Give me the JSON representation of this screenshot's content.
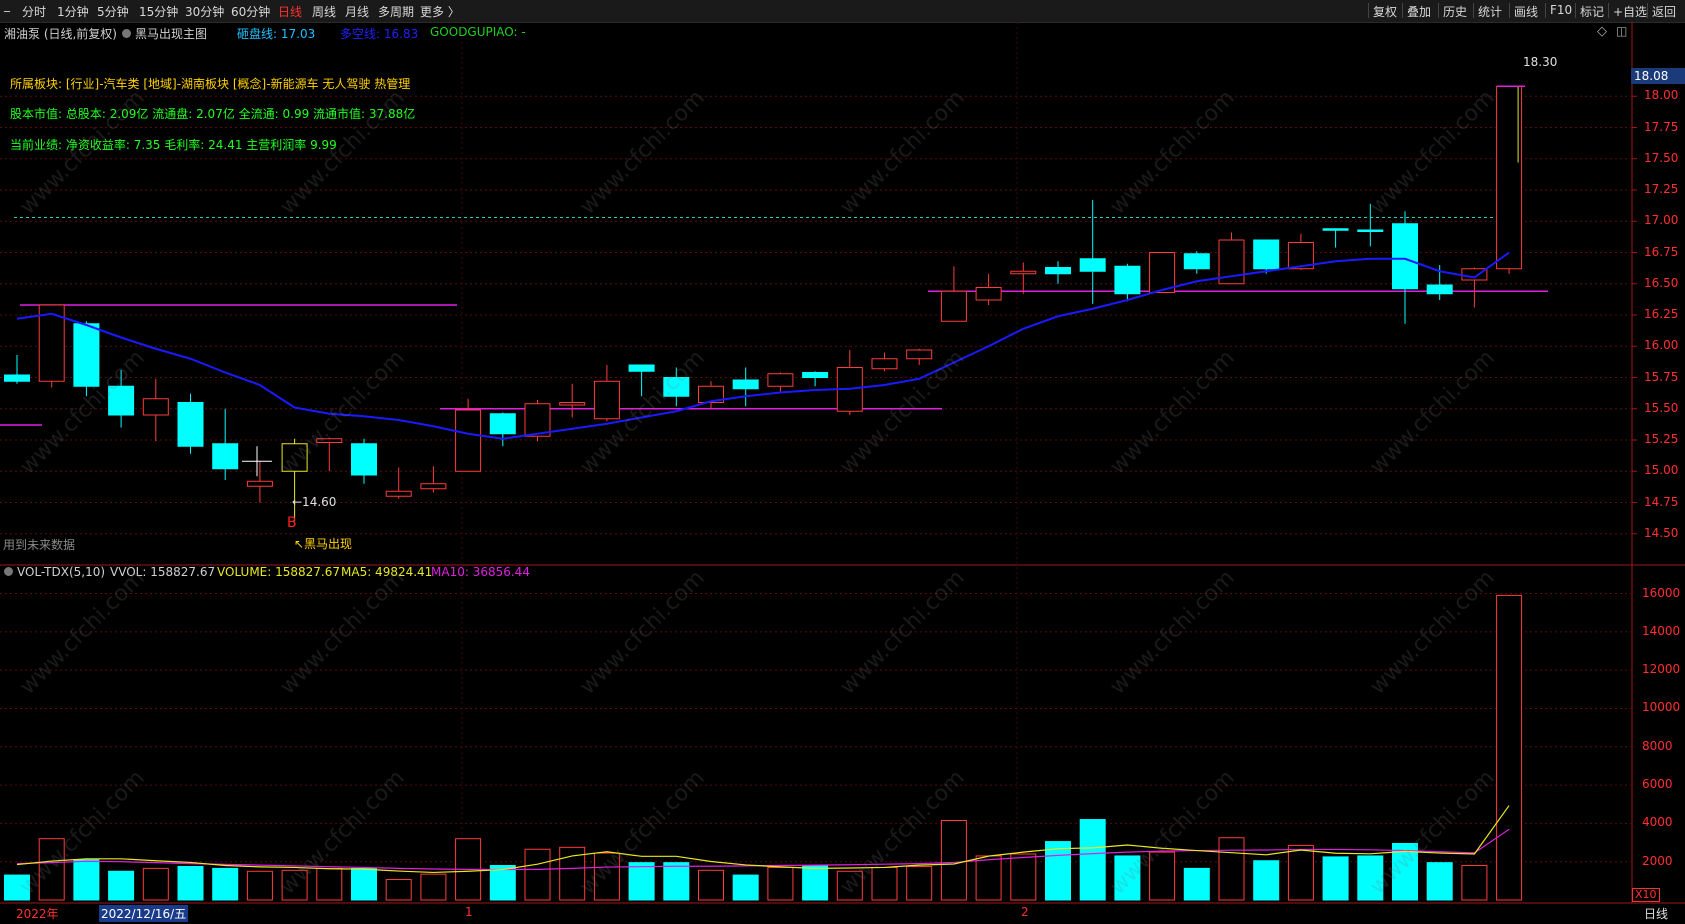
{
  "toolbar": {
    "periods": [
      "分时",
      "1分钟",
      "5分钟",
      "15分钟",
      "30分钟",
      "60分钟",
      "日线",
      "周线",
      "月线",
      "多周期",
      "更多 〉"
    ],
    "active_period": "日线",
    "right_buttons": [
      "复权",
      "叠加",
      "历史",
      "统计",
      "画线",
      "F10",
      "标记",
      "+自选",
      "返回"
    ],
    "minimize": "_",
    "close": "□"
  },
  "header": {
    "stock_name": "湘油泵 (日线,前复权)",
    "indicator_name": "黑马出现主图",
    "line1_label": "砸盘线: 17.03",
    "line2_label": "多空线: 16.83",
    "line3_label": "GOODGUPIAO: -"
  },
  "info": {
    "sector": "所属板块: [行业]-汽车类 [地域]-湖南板块 [概念]-新能源车 无人驾驶 热管理",
    "capital": "股本市值: 总股本: 2.09亿 流通盘: 2.07亿 全流通: 0.99 流通市值: 37.88亿",
    "performance": "当前业绩: 净资收益率: 7.35 毛利率: 24.41 主营利润率 9.99"
  },
  "price_axis": {
    "labels": [
      "18.00",
      "17.75",
      "17.50",
      "17.25",
      "17.00",
      "16.75",
      "16.50",
      "16.25",
      "16.00",
      "15.75",
      "15.50",
      "15.25",
      "15.00",
      "14.75",
      "14.50"
    ],
    "current_price": "18.08",
    "high_marker": "18.30",
    "low_marker": "←14.60"
  },
  "signals": {
    "buy_letter": "B",
    "buy_text": "↖黑马出现",
    "future_note": "用到未来数据"
  },
  "volume": {
    "indicator": "VOL-TDX(5,10)",
    "vvol": "VVOL: 158827.67",
    "volume": "VOLUME: 158827.67",
    "ma5": "MA5: 49824.41",
    "ma10": "MA10: 36856.44",
    "axis_labels": [
      "16000",
      "14000",
      "12000",
      "10000",
      "8000",
      "6000",
      "4000",
      "2000"
    ],
    "unit": "X10"
  },
  "timeline": {
    "year": "2022年",
    "cursor_date": "2022/12/16/五",
    "month1": "1",
    "month2": "2",
    "period_label": "日线"
  },
  "watermark": "www.cfchi.com",
  "colors": {
    "up": "#ff3b3b",
    "down": "#00ffff",
    "ma_line": "#1a1aff",
    "magenta": "#e020e0",
    "yellow": "#e8e820",
    "green_text": "#20ff20",
    "gold_text": "#ffd000"
  },
  "chart_data": {
    "type": "candlestick",
    "candles": [
      {
        "o": 15.77,
        "c": 15.72,
        "h": 15.93,
        "l": 15.7
      },
      {
        "o": 15.72,
        "c": 16.33,
        "h": 16.33,
        "l": 15.67
      },
      {
        "o": 16.18,
        "c": 15.68,
        "h": 16.2,
        "l": 15.6
      },
      {
        "o": 15.68,
        "c": 15.45,
        "h": 15.81,
        "l": 15.35
      },
      {
        "o": 15.45,
        "c": 15.58,
        "h": 15.74,
        "l": 15.24
      },
      {
        "o": 15.55,
        "c": 15.2,
        "h": 15.62,
        "l": 15.14
      },
      {
        "o": 15.22,
        "c": 15.02,
        "h": 15.5,
        "l": 14.93
      },
      {
        "o": 14.88,
        "c": 14.92,
        "h": 15.08,
        "l": 14.75
      },
      {
        "o": 15.0,
        "c": 15.22,
        "h": 15.26,
        "l": 14.6
      },
      {
        "o": 15.23,
        "c": 15.26,
        "h": 15.27,
        "l": 15.0
      },
      {
        "o": 15.22,
        "c": 14.97,
        "h": 15.26,
        "l": 14.9
      },
      {
        "o": 14.8,
        "c": 14.84,
        "h": 15.03,
        "l": 14.78
      },
      {
        "o": 14.86,
        "c": 14.9,
        "h": 15.04,
        "l": 14.83
      },
      {
        "o": 15.0,
        "c": 15.49,
        "h": 15.58,
        "l": 15.0
      },
      {
        "o": 15.46,
        "c": 15.3,
        "h": 15.47,
        "l": 15.2
      },
      {
        "o": 15.28,
        "c": 15.54,
        "h": 15.57,
        "l": 15.24
      },
      {
        "o": 15.53,
        "c": 15.55,
        "h": 15.7,
        "l": 15.43
      },
      {
        "o": 15.42,
        "c": 15.72,
        "h": 15.85,
        "l": 15.4
      },
      {
        "o": 15.85,
        "c": 15.8,
        "h": 15.85,
        "l": 15.6
      },
      {
        "o": 15.75,
        "c": 15.6,
        "h": 15.83,
        "l": 15.52
      },
      {
        "o": 15.55,
        "c": 15.68,
        "h": 15.72,
        "l": 15.5
      },
      {
        "o": 15.73,
        "c": 15.66,
        "h": 15.83,
        "l": 15.52
      },
      {
        "o": 15.68,
        "c": 15.78,
        "h": 15.79,
        "l": 15.63
      },
      {
        "o": 15.79,
        "c": 15.75,
        "h": 15.8,
        "l": 15.68
      },
      {
        "o": 15.48,
        "c": 15.83,
        "h": 15.97,
        "l": 15.45
      },
      {
        "o": 15.82,
        "c": 15.9,
        "h": 15.95,
        "l": 15.8
      },
      {
        "o": 15.9,
        "c": 15.97,
        "h": 15.98,
        "l": 15.85
      },
      {
        "o": 16.2,
        "c": 16.44,
        "h": 16.64,
        "l": 16.2
      },
      {
        "o": 16.37,
        "c": 16.47,
        "h": 16.58,
        "l": 16.33
      },
      {
        "o": 16.58,
        "c": 16.6,
        "h": 16.67,
        "l": 16.42
      },
      {
        "o": 16.63,
        "c": 16.58,
        "h": 16.68,
        "l": 16.5
      },
      {
        "o": 16.7,
        "c": 16.6,
        "h": 17.17,
        "l": 16.34
      },
      {
        "o": 16.64,
        "c": 16.42,
        "h": 16.66,
        "l": 16.36
      },
      {
        "o": 16.43,
        "c": 16.75,
        "h": 16.75,
        "l": 16.43
      },
      {
        "o": 16.74,
        "c": 16.62,
        "h": 16.76,
        "l": 16.58
      },
      {
        "o": 16.5,
        "c": 16.85,
        "h": 16.91,
        "l": 16.5
      },
      {
        "o": 16.85,
        "c": 16.62,
        "h": 16.85,
        "l": 16.58
      },
      {
        "o": 16.62,
        "c": 16.83,
        "h": 16.9,
        "l": 16.61
      },
      {
        "o": 16.94,
        "c": 16.93,
        "h": 16.94,
        "l": 16.79
      },
      {
        "o": 16.93,
        "c": 16.92,
        "h": 17.14,
        "l": 16.8
      },
      {
        "o": 16.98,
        "c": 16.46,
        "h": 17.08,
        "l": 16.18
      },
      {
        "o": 16.49,
        "c": 16.42,
        "h": 16.65,
        "l": 16.37
      },
      {
        "o": 16.53,
        "c": 16.62,
        "h": 16.63,
        "l": 16.31
      },
      {
        "o": 16.62,
        "c": 18.08,
        "h": 18.08,
        "l": 16.58
      }
    ],
    "ma": [
      16.22,
      16.26,
      16.17,
      16.07,
      15.98,
      15.9,
      15.79,
      15.69,
      15.51,
      15.46,
      15.44,
      15.41,
      15.36,
      15.3,
      15.26,
      15.3,
      15.34,
      15.38,
      15.43,
      15.48,
      15.56,
      15.6,
      15.63,
      15.65,
      15.66,
      15.69,
      15.74,
      15.87,
      16.0,
      16.14,
      16.24,
      16.3,
      16.37,
      16.45,
      16.52,
      16.56,
      16.6,
      16.64,
      16.68,
      16.7,
      16.7,
      16.6,
      16.55,
      16.75
    ],
    "volumes": [
      1300,
      3200,
      2100,
      1500,
      1650,
      1750,
      1650,
      1500,
      1550,
      1650,
      1650,
      1070,
      1350,
      3200,
      1800,
      2650,
      2750,
      2450,
      1950,
      1950,
      1550,
      1300,
      1700,
      1800,
      1500,
      1700,
      1750,
      4150,
      2300,
      2400,
      3050,
      4200,
      2300,
      2500,
      1650,
      3250,
      2050,
      2850,
      2250,
      2300,
      2950,
      1950,
      1800,
      15900
    ],
    "vol_ma5": [
      1850,
      2030,
      2150,
      2150,
      2050,
      1960,
      1800,
      1730,
      1700,
      1630,
      1610,
      1510,
      1440,
      1500,
      1590,
      1870,
      2300,
      2520,
      2280,
      2280,
      2010,
      1830,
      1730,
      1650,
      1670,
      1700,
      1820,
      1880,
      2290,
      2500,
      2680,
      2720,
      2870,
      2700,
      2580,
      2470,
      2360,
      2610,
      2440,
      2410,
      2540,
      2450,
      2400,
      4930
    ],
    "vol_ma10": [
      1900,
      1950,
      2020,
      2000,
      1950,
      1900,
      1860,
      1820,
      1780,
      1740,
      1700,
      1650,
      1620,
      1600,
      1590,
      1600,
      1650,
      1720,
      1740,
      1760,
      1760,
      1780,
      1800,
      1820,
      1840,
      1870,
      1900,
      1960,
      2100,
      2220,
      2330,
      2420,
      2500,
      2550,
      2580,
      2600,
      2610,
      2640,
      2640,
      2620,
      2580,
      2520,
      2460,
      3690
    ],
    "ylim": [
      14.29,
      18.33
    ],
    "vol_ylim": [
      0,
      16000
    ],
    "line_high": 17.03,
    "line_dashed": 17.03,
    "magenta_segments": [
      {
        "from": 0,
        "to": 12,
        "y": 16.33
      },
      {
        "from": 12,
        "to": 26,
        "y": 15.5
      },
      {
        "from": 26,
        "to": 42,
        "y": 16.44
      }
    ]
  }
}
